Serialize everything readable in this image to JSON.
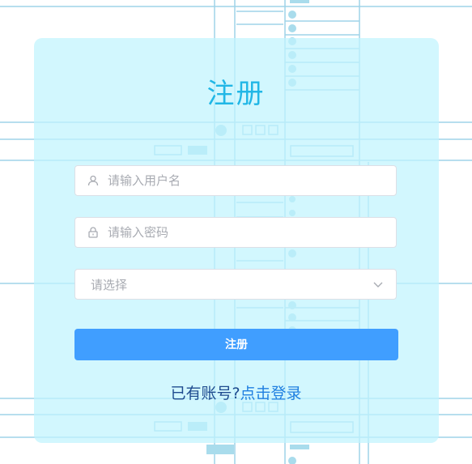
{
  "title": "注册",
  "username": {
    "placeholder": "请输入用户名",
    "icon": "user-icon"
  },
  "password": {
    "placeholder": "请输入密码",
    "icon": "lock-icon"
  },
  "role_select": {
    "placeholder": "请选择",
    "icon": "chevron-down-icon"
  },
  "submit_label": "注册",
  "footer": {
    "prompt": "已有账号?",
    "login_link": "点击登录"
  },
  "colors": {
    "accent": "#409eff",
    "title": "#21b7e6",
    "card": "#c1f4fd"
  }
}
